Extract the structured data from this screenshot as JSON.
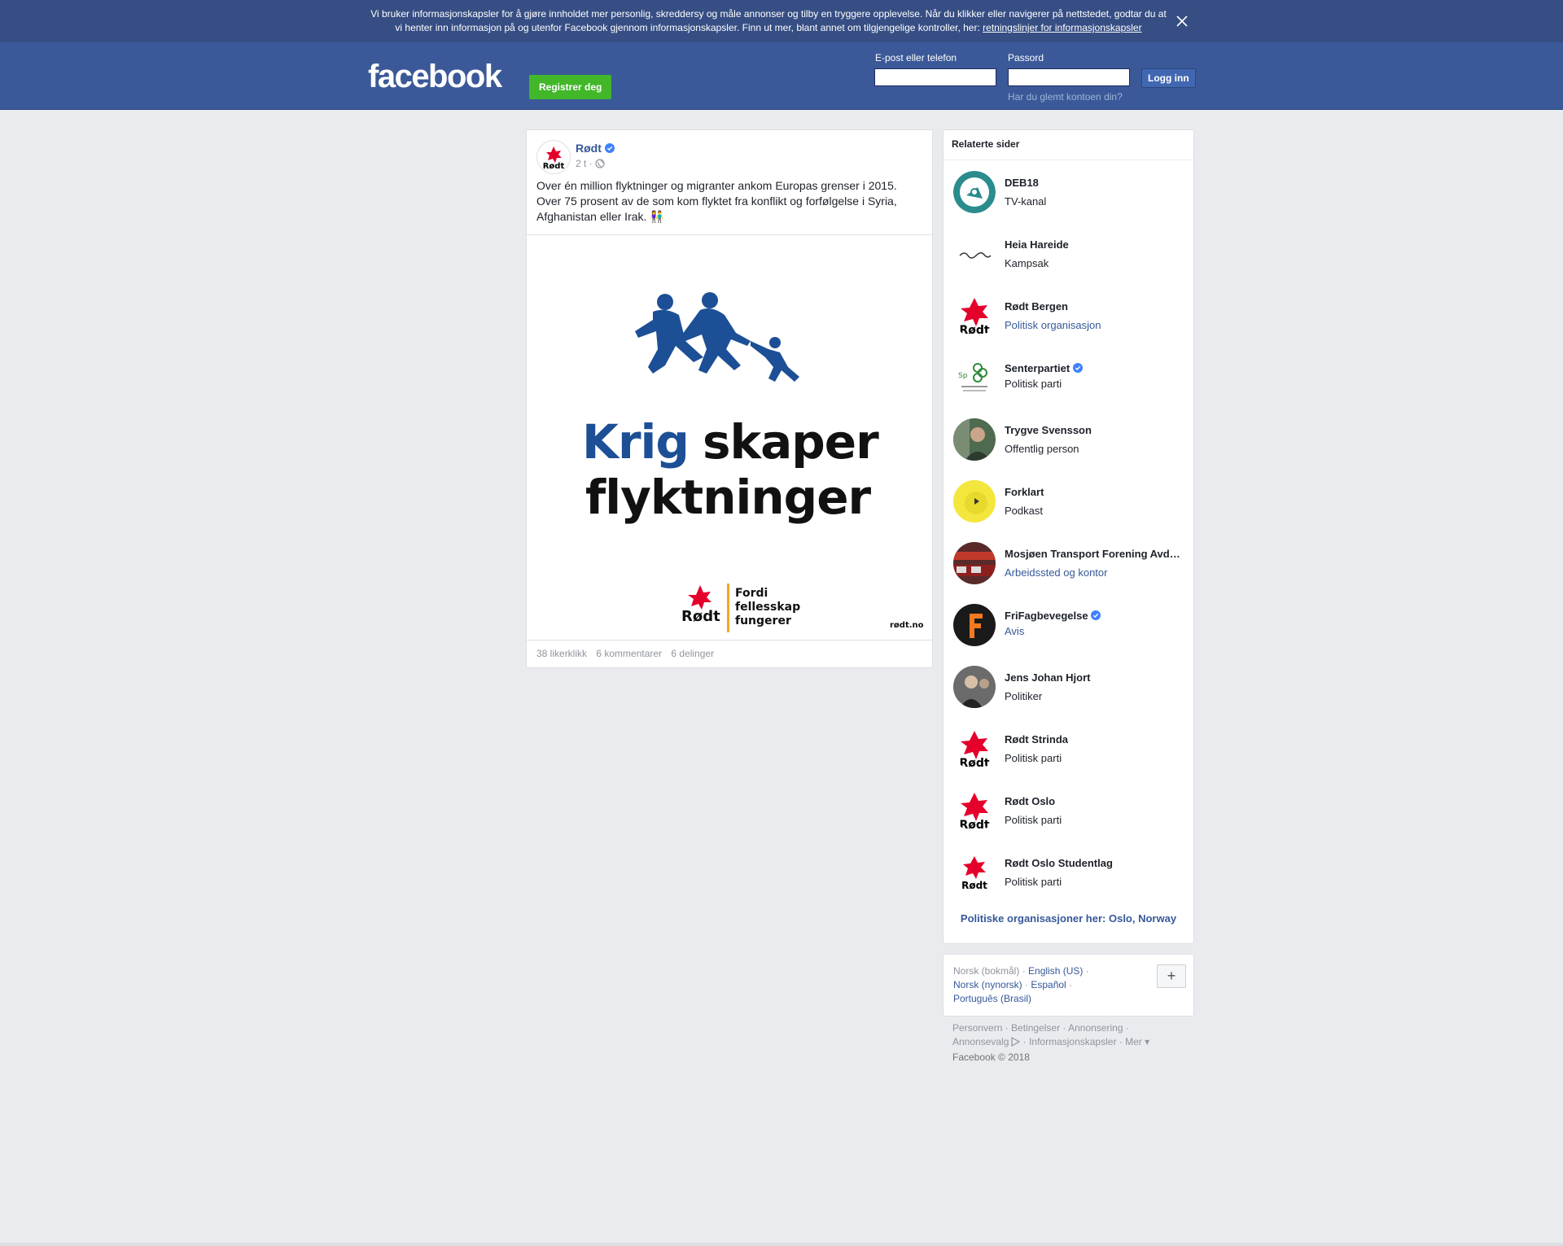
{
  "cookie_banner": {
    "text": "Vi bruker informasjonskapsler for å gjøre innholdet mer personlig, skreddersy og måle annonser og tilby en tryggere opplevelse. Når du klikker eller navigerer på nettstedet, godtar du at vi henter inn informasjon på og utenfor Facebook gjennom informasjonskapsler. Finn ut mer, blant annet om tilgjengelige kontroller, her: ",
    "link": "retningslinjer for informasjonskapsler",
    "close_icon": "close-icon"
  },
  "header": {
    "logo": "facebook",
    "register_label": "Registrer deg",
    "email_label": "E-post eller telefon",
    "email_value": "",
    "password_label": "Passord",
    "password_value": "",
    "login_label": "Logg inn",
    "forgot_label": "Har du glemt kontoen din?"
  },
  "post": {
    "author": "Rødt",
    "time": "2 t · ",
    "text": "Over én million flyktninger og migranter ankom Europas grenser i 2015. Over 75 prosent av de som kom flyktet fra konflikt og forfølgelse i Syria, Afghanistan eller Irak. 👫",
    "image": {
      "word1": "Krig",
      "word2": "skaper",
      "word3": "flyktninger",
      "logo_text": "Rødt",
      "slogan1": "Fordi",
      "slogan2": "fellesskap",
      "slogan3": "fungerer",
      "url": "rødt.no",
      "blue": "#1c4f96"
    },
    "likes": "38 likerklikk",
    "comments": "6 kommentarer",
    "shares": "6 delinger"
  },
  "related": {
    "title": "Relaterte sider",
    "items": [
      {
        "name": "DEB18",
        "category": "TV-kanal",
        "verified": false,
        "link": false
      },
      {
        "name": "Heia Hareide",
        "category": "Kampsak",
        "verified": false,
        "link": false
      },
      {
        "name": "Rødt Bergen",
        "category": "Politisk organisasjon",
        "verified": false,
        "link": true
      },
      {
        "name": "Senterpartiet",
        "category": "Politisk parti",
        "verified": true,
        "link": false
      },
      {
        "name": "Trygve Svensson",
        "category": "Offentlig person",
        "verified": false,
        "link": false
      },
      {
        "name": "Forklart",
        "category": "Podkast",
        "verified": false,
        "link": false
      },
      {
        "name": "Mosjøen Transport Forening Avd…",
        "category": "Arbeidssted og kontor",
        "verified": false,
        "link": true
      },
      {
        "name": "FriFagbevegelse",
        "category": "Avis",
        "verified": true,
        "link": true
      },
      {
        "name": "Jens Johan Hjort",
        "category": "Politiker",
        "verified": false,
        "link": false
      },
      {
        "name": "Rødt Strinda",
        "category": "Politisk parti",
        "verified": false,
        "link": false
      },
      {
        "name": "Rødt Oslo",
        "category": "Politisk parti",
        "verified": false,
        "link": false
      },
      {
        "name": "Rødt Oslo Studentlag",
        "category": "Politisk parti",
        "verified": false,
        "link": false
      }
    ],
    "footer": "Politiske organisasjoner her: Oslo, Norway"
  },
  "languages": {
    "current": "Norsk (bokmål)",
    "others": [
      "English (US)",
      "Norsk (nynorsk)",
      "Español",
      "Português (Brasil)"
    ],
    "plus": "+"
  },
  "footer": {
    "links": [
      "Personvern",
      "Betingelser",
      "Annonsering",
      "Annonsevalg",
      "Informasjonskapsler",
      "Mer"
    ],
    "copyright": "Facebook © 2018"
  },
  "colors": {
    "brand": "#3b5998",
    "register": "#42b72a",
    "link": "#365899",
    "rodt_red": "#e4002b"
  }
}
